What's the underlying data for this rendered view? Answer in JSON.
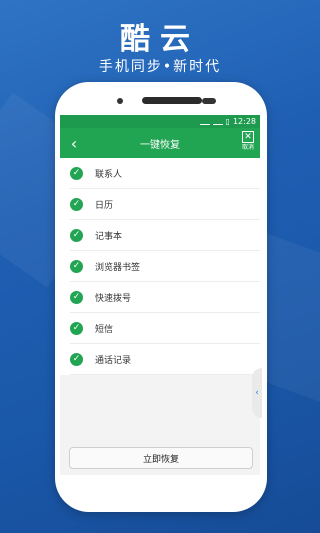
{
  "brand": {
    "name": "酷云",
    "slogan": "手机同步•新时代"
  },
  "status_bar": {
    "time": "12:28"
  },
  "header": {
    "title": "一键恢复",
    "cancel_label": "取消"
  },
  "items": [
    {
      "label": "联系人",
      "checked": true
    },
    {
      "label": "日历",
      "checked": true
    },
    {
      "label": "记事本",
      "checked": true
    },
    {
      "label": "浏览器书签",
      "checked": true
    },
    {
      "label": "快速拨号",
      "checked": true
    },
    {
      "label": "短信",
      "checked": true
    },
    {
      "label": "通话记录",
      "checked": true
    }
  ],
  "restore_button": {
    "label": "立即恢复"
  },
  "colors": {
    "accent": "#22a553",
    "background": "#1f5fb3"
  }
}
